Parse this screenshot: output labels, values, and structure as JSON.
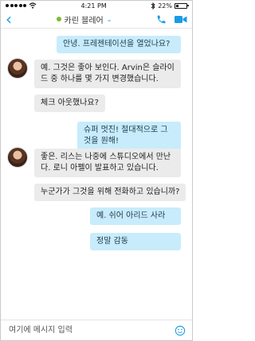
{
  "status": {
    "time": "4:21 PM",
    "battery": "22%"
  },
  "header": {
    "title": "카린 블레어"
  },
  "messages": [
    {
      "dir": "out",
      "text": "안녕. 프레젠테이션을 열었나요?"
    },
    {
      "dir": "in",
      "text": "예. 그것은 좋아 보인다. Arvin은 슬라이드 중 하나를 몇 가지 변경했습니다."
    },
    {
      "dir": "in",
      "text": "체크 아웃했나요?"
    },
    {
      "dir": "out",
      "text": "슈퍼 멋진! 절대적으로 그것을 원해!"
    },
    {
      "dir": "in",
      "text": "좋은. 리스는 나중에 스튜디오에서 만난다. 로니 아펠이 발표하고 있습니다."
    },
    {
      "dir": "in",
      "text": "누군가가 그것을 위해 전화하고 있습니까?"
    },
    {
      "dir": "out",
      "text": "예. 쉬어 아리드 사라"
    },
    {
      "dir": "out",
      "text": "정말 감동"
    }
  ],
  "composer": {
    "placeholder": "여기에 메시지 입력"
  },
  "colors": {
    "accent": "#1a9be6",
    "outgoing_bubble": "#c8ecfb",
    "incoming_bubble": "#ebebeb",
    "presence": "#7cbb2f"
  }
}
